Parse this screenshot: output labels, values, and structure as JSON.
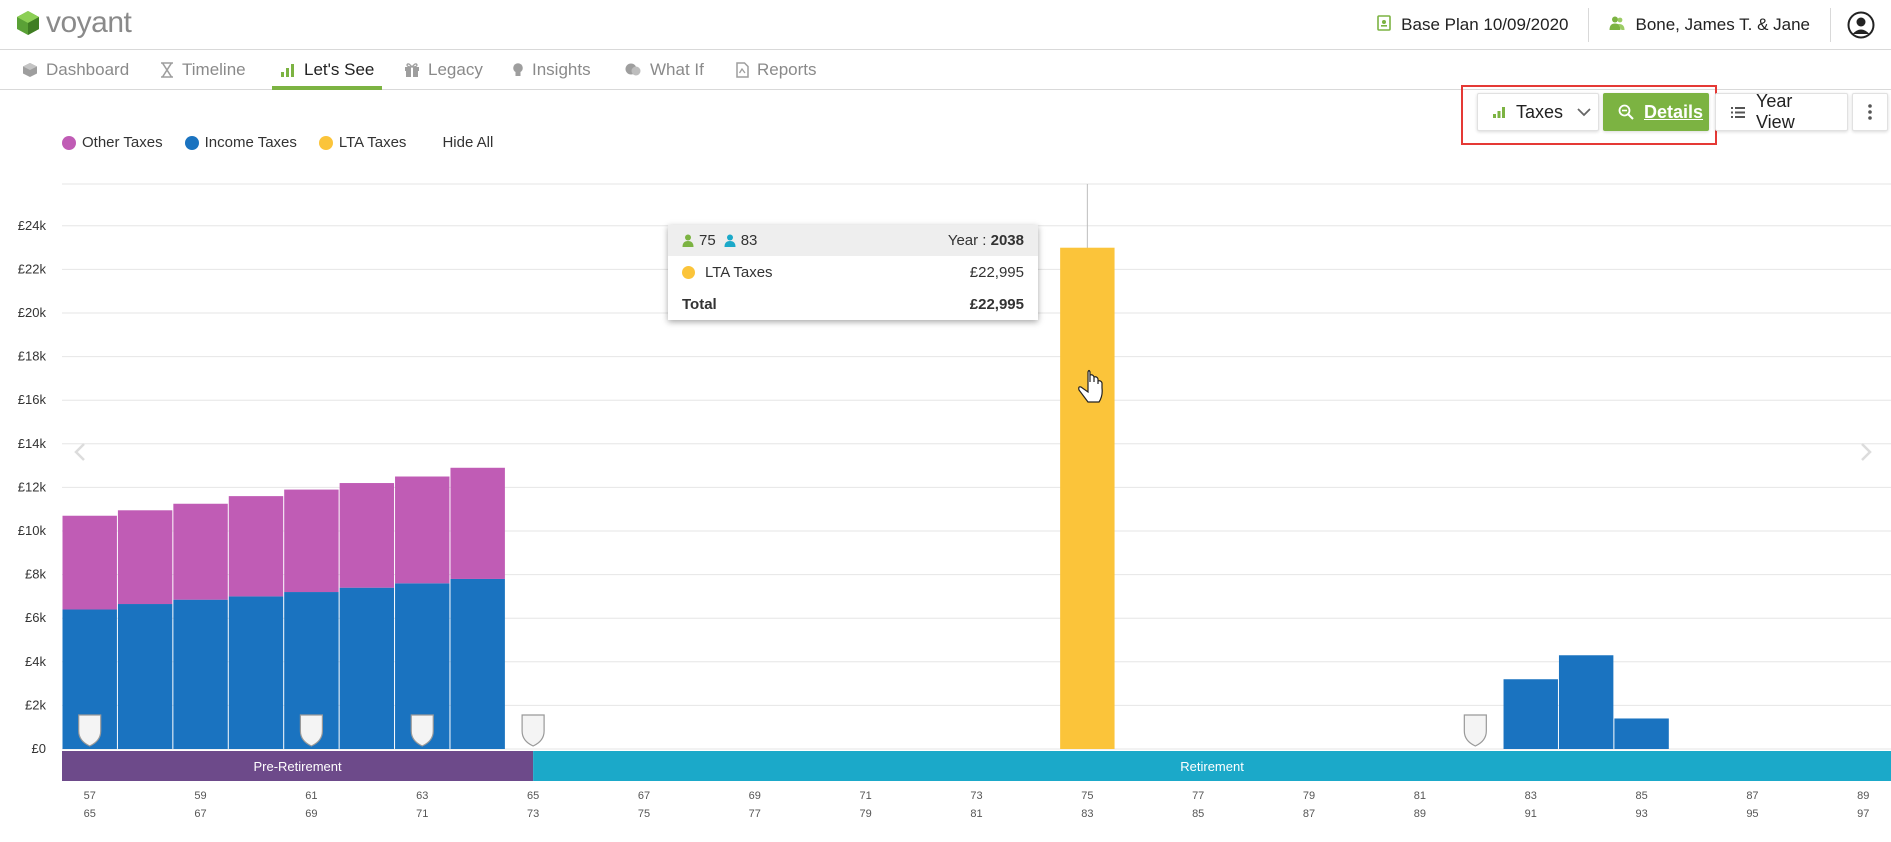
{
  "app": {
    "logo_text": "voyant",
    "plan_label": "Base Plan 10/09/2020",
    "client_label": "Bone, James T. & Jane"
  },
  "nav": {
    "items": [
      {
        "label": "Dashboard",
        "icon": "cube-icon"
      },
      {
        "label": "Timeline",
        "icon": "hourglass-icon"
      },
      {
        "label": "Let's See",
        "icon": "bar-chart-icon",
        "active": true
      },
      {
        "label": "Legacy",
        "icon": "gift-icon"
      },
      {
        "label": "Insights",
        "icon": "lightbulb-icon"
      },
      {
        "label": "What If",
        "icon": "what-if-icon"
      },
      {
        "label": "Reports",
        "icon": "report-icon"
      }
    ]
  },
  "controls": {
    "chart_select": "Taxes",
    "details": "Details",
    "year_view": "Year View"
  },
  "legend": {
    "items": [
      {
        "label": "Other Taxes",
        "color": "#c05cb5"
      },
      {
        "label": "Income Taxes",
        "color": "#1a73c0"
      },
      {
        "label": "LTA Taxes",
        "color": "#fbc43a"
      }
    ],
    "hide_all": "Hide All"
  },
  "tooltip": {
    "age1": "75",
    "age2": "83",
    "year_label": "Year : ",
    "year": "2038",
    "row_label": "LTA Taxes",
    "row_value": "£22,995",
    "total_label": "Total",
    "total_value": "£22,995"
  },
  "chart_data": {
    "type": "bar",
    "stacked": true,
    "y_ticks": [
      "£0",
      "£2k",
      "£4k",
      "£6k",
      "£8k",
      "£10k",
      "£12k",
      "£14k",
      "£16k",
      "£18k",
      "£20k",
      "£22k",
      "£24k"
    ],
    "ylim": [
      0,
      26000
    ],
    "age1": [
      "57",
      "58",
      "59",
      "60",
      "61",
      "62",
      "63",
      "64",
      "65",
      "66",
      "67",
      "68",
      "69",
      "70",
      "71",
      "72",
      "73",
      "74",
      "75",
      "76",
      "77",
      "78",
      "79",
      "80",
      "81",
      "82",
      "83",
      "84",
      "85",
      "86",
      "87",
      "88",
      "89"
    ],
    "age2": [
      "65",
      "66",
      "67",
      "68",
      "69",
      "70",
      "71",
      "72",
      "73",
      "74",
      "75",
      "76",
      "77",
      "78",
      "79",
      "80",
      "81",
      "82",
      "83",
      "84",
      "85",
      "86",
      "87",
      "88",
      "89",
      "90",
      "91",
      "92",
      "93",
      "94",
      "95",
      "96",
      "97"
    ],
    "label_every": 2,
    "series": [
      {
        "name": "Income Taxes",
        "color": "#1a73c0",
        "values": [
          6400,
          6650,
          6850,
          7000,
          7200,
          7400,
          7600,
          7800,
          0,
          0,
          0,
          0,
          0,
          0,
          0,
          0,
          0,
          0,
          0,
          0,
          0,
          0,
          0,
          0,
          0,
          0,
          3200,
          4300,
          1400,
          0,
          0,
          0,
          0
        ]
      },
      {
        "name": "Other Taxes",
        "color": "#c05cb5",
        "values": [
          4300,
          4300,
          4400,
          4600,
          4700,
          4800,
          4900,
          5100,
          0,
          0,
          0,
          0,
          0,
          0,
          0,
          0,
          0,
          0,
          0,
          0,
          0,
          0,
          0,
          0,
          0,
          0,
          0,
          0,
          0,
          0,
          0,
          0,
          0
        ]
      },
      {
        "name": "LTA Taxes",
        "color": "#fbc43a",
        "values": [
          0,
          0,
          0,
          0,
          0,
          0,
          0,
          0,
          0,
          0,
          0,
          0,
          0,
          0,
          0,
          0,
          0,
          0,
          22995,
          0,
          0,
          0,
          0,
          0,
          0,
          0,
          0,
          0,
          0,
          0,
          0,
          0,
          0
        ]
      }
    ],
    "markers": [
      0,
      4,
      6,
      8,
      25
    ],
    "phases": [
      {
        "label": "Pre-Retirement",
        "color": "#6d4a8a",
        "start": 0,
        "end": 8.5
      },
      {
        "label": "Retirement",
        "color": "#1ba9c9",
        "start": 8.5,
        "end": 33
      }
    ],
    "hover_index": 18
  }
}
